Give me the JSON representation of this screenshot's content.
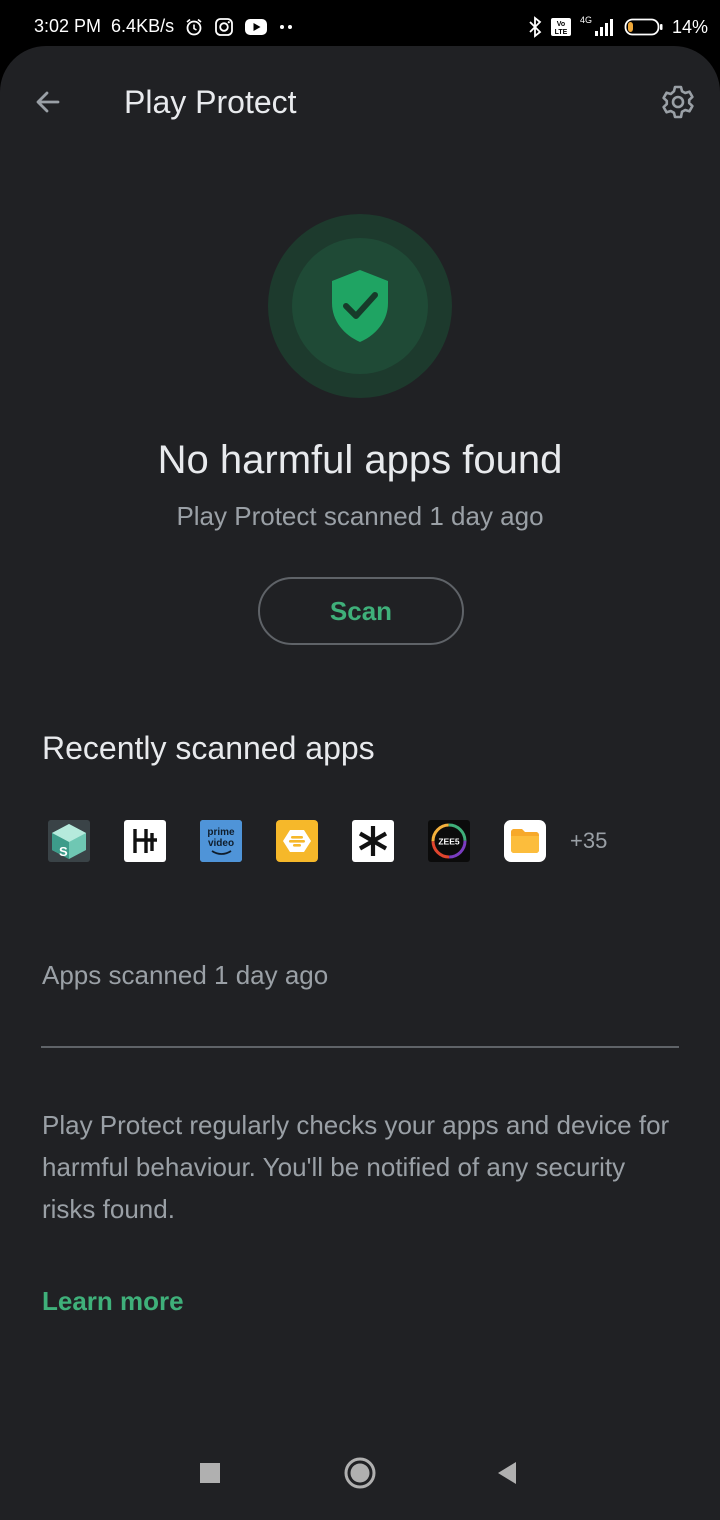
{
  "status_bar": {
    "time": "3:02 PM",
    "speed": "6.4KB/s",
    "network": "4G",
    "battery": "14%",
    "icons": [
      "alarm-icon",
      "instagram-icon",
      "youtube-icon",
      "more-dots-icon",
      "bluetooth-icon",
      "volte-icon",
      "signal-icon",
      "battery-icon"
    ]
  },
  "header": {
    "title": "Play Protect",
    "back_icon": "back-arrow-icon",
    "settings_icon": "gear-icon"
  },
  "status": {
    "icon": "shield-check-icon",
    "headline": "No harmful apps found",
    "subline": "Play Protect scanned 1 day ago",
    "scan_label": "Scan"
  },
  "recent": {
    "title": "Recently scanned apps",
    "apps": [
      {
        "icon": "blue-box-app-icon"
      },
      {
        "icon": "h-app-icon"
      },
      {
        "icon": "prime-video-app-icon",
        "text": "prime video"
      },
      {
        "icon": "bumble-app-icon"
      },
      {
        "icon": "asterisk-app-icon"
      },
      {
        "icon": "zee5-app-icon",
        "text": "ZEE5"
      },
      {
        "icon": "files-app-icon"
      }
    ],
    "more_count": "+35",
    "scanned_text": "Apps scanned 1 day ago"
  },
  "info": {
    "description": "Play Protect regularly checks your apps and device for harmful behaviour. You'll be notified of any security risks found.",
    "learn_more": "Learn more"
  },
  "colors": {
    "accent": "#3fb07a",
    "background": "#202124",
    "text_primary": "#e8eaed",
    "text_secondary": "#9aa0a6"
  },
  "nav": {
    "icons": [
      "recents-square-icon",
      "home-circle-icon",
      "back-triangle-icon"
    ]
  }
}
